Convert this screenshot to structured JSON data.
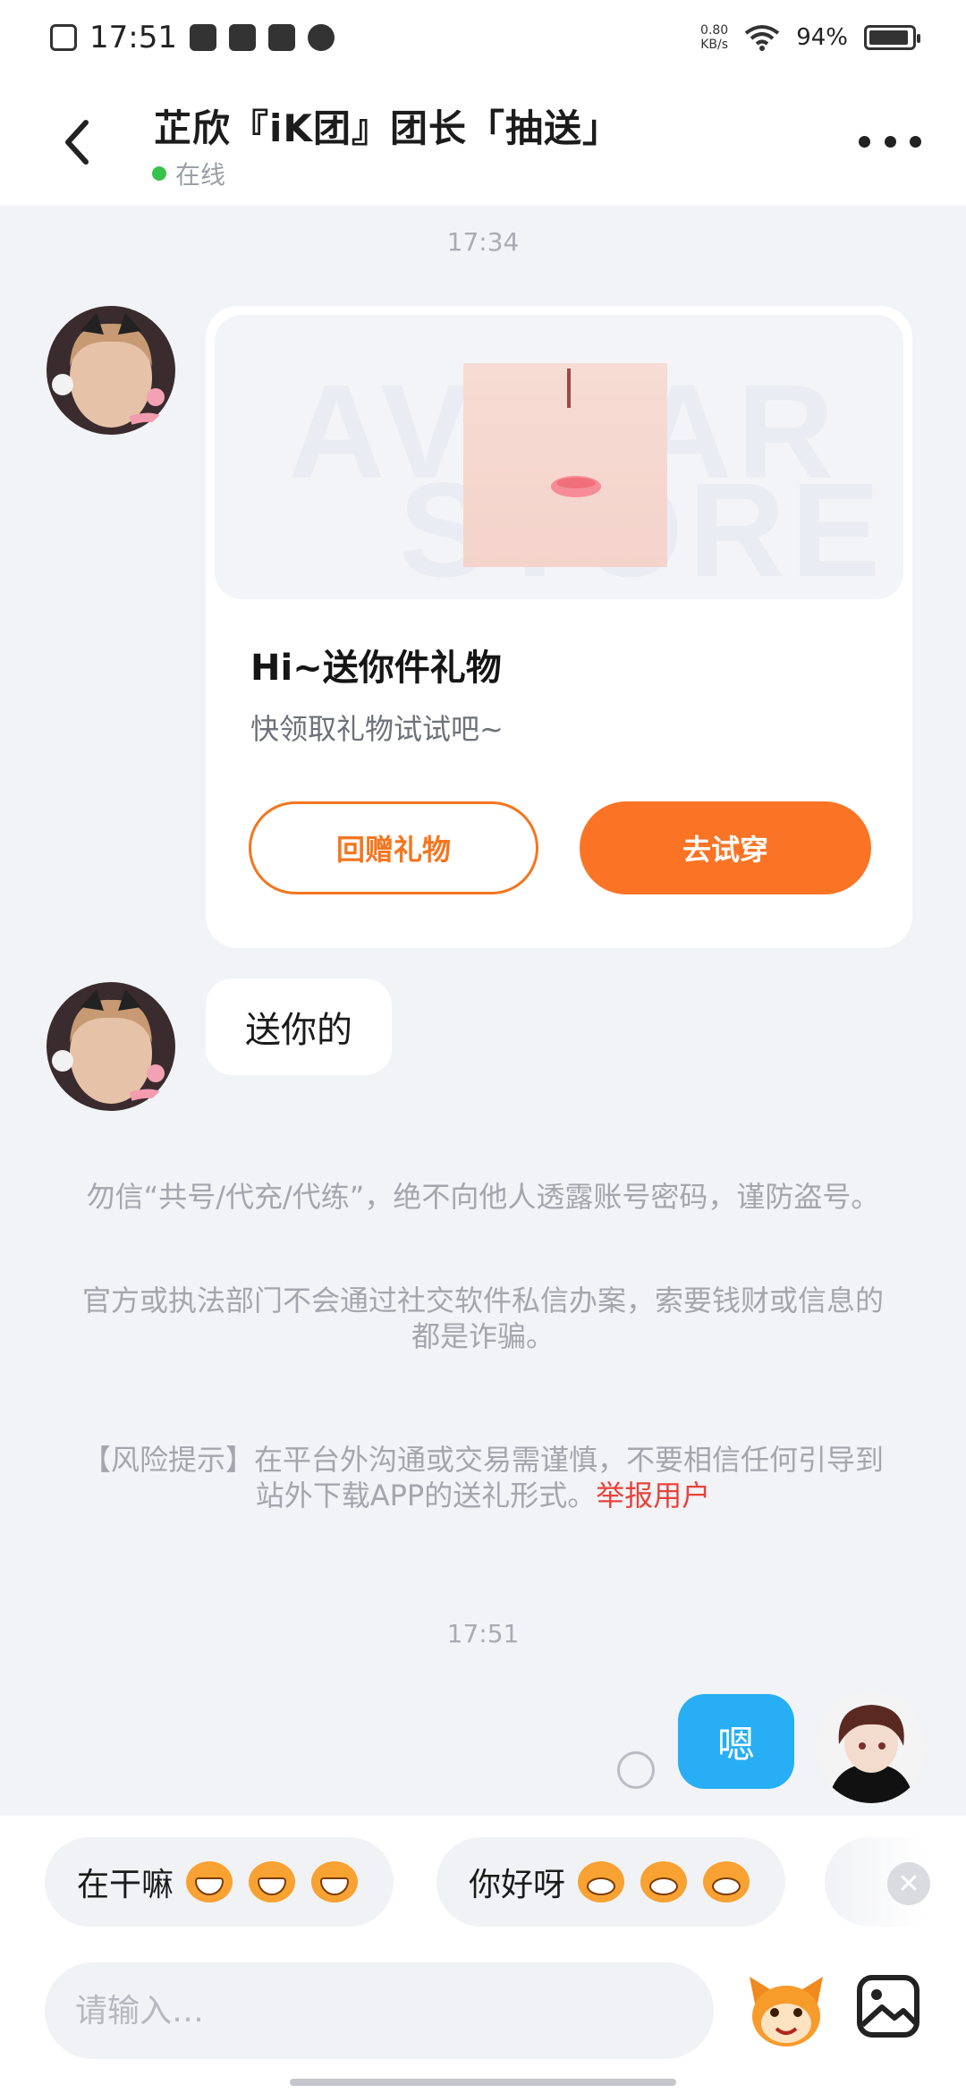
{
  "status_bar": {
    "time": "17:51",
    "net_speed_value": "0.80",
    "net_speed_unit": "KB/s",
    "battery_pct": "94%",
    "battery_level": 0.94
  },
  "header": {
    "title": "芷欣『iK团』团长「抽送」",
    "online_status": "在线"
  },
  "messages": {
    "time_1": "17:34",
    "gift_card": {
      "banner_text_1": "AVATAR",
      "banner_text_2": "STORE",
      "title": "Hi~送你件礼物",
      "subtitle": "快领取礼物试试吧~",
      "return_gift_label": "回赠礼物",
      "try_on_label": "去试穿"
    },
    "text_in": "送你的",
    "notice_1": "勿信“共号/代充/代练”，绝不向他人透露账号密码，谨防盗号。",
    "notice_2": "官方或执法部门不会通过社交软件私信办案，索要钱财或信息的都是诈骗。",
    "notice_3": "【风险提示】在平台外沟通或交易需谨慎，不要相信任何引导到站外下载APP的送礼形式。",
    "report_user": "举报用户",
    "time_2": "17:51",
    "text_out": "嗯"
  },
  "quick_replies": [
    {
      "label": "在干嘛"
    },
    {
      "label": "你好呀"
    }
  ],
  "input": {
    "placeholder": "请输入…"
  },
  "colors": {
    "accent_orange": "#fb7324",
    "bubble_blue": "#27aef4",
    "online_green": "#37c24a",
    "report_red": "#e8433b"
  }
}
